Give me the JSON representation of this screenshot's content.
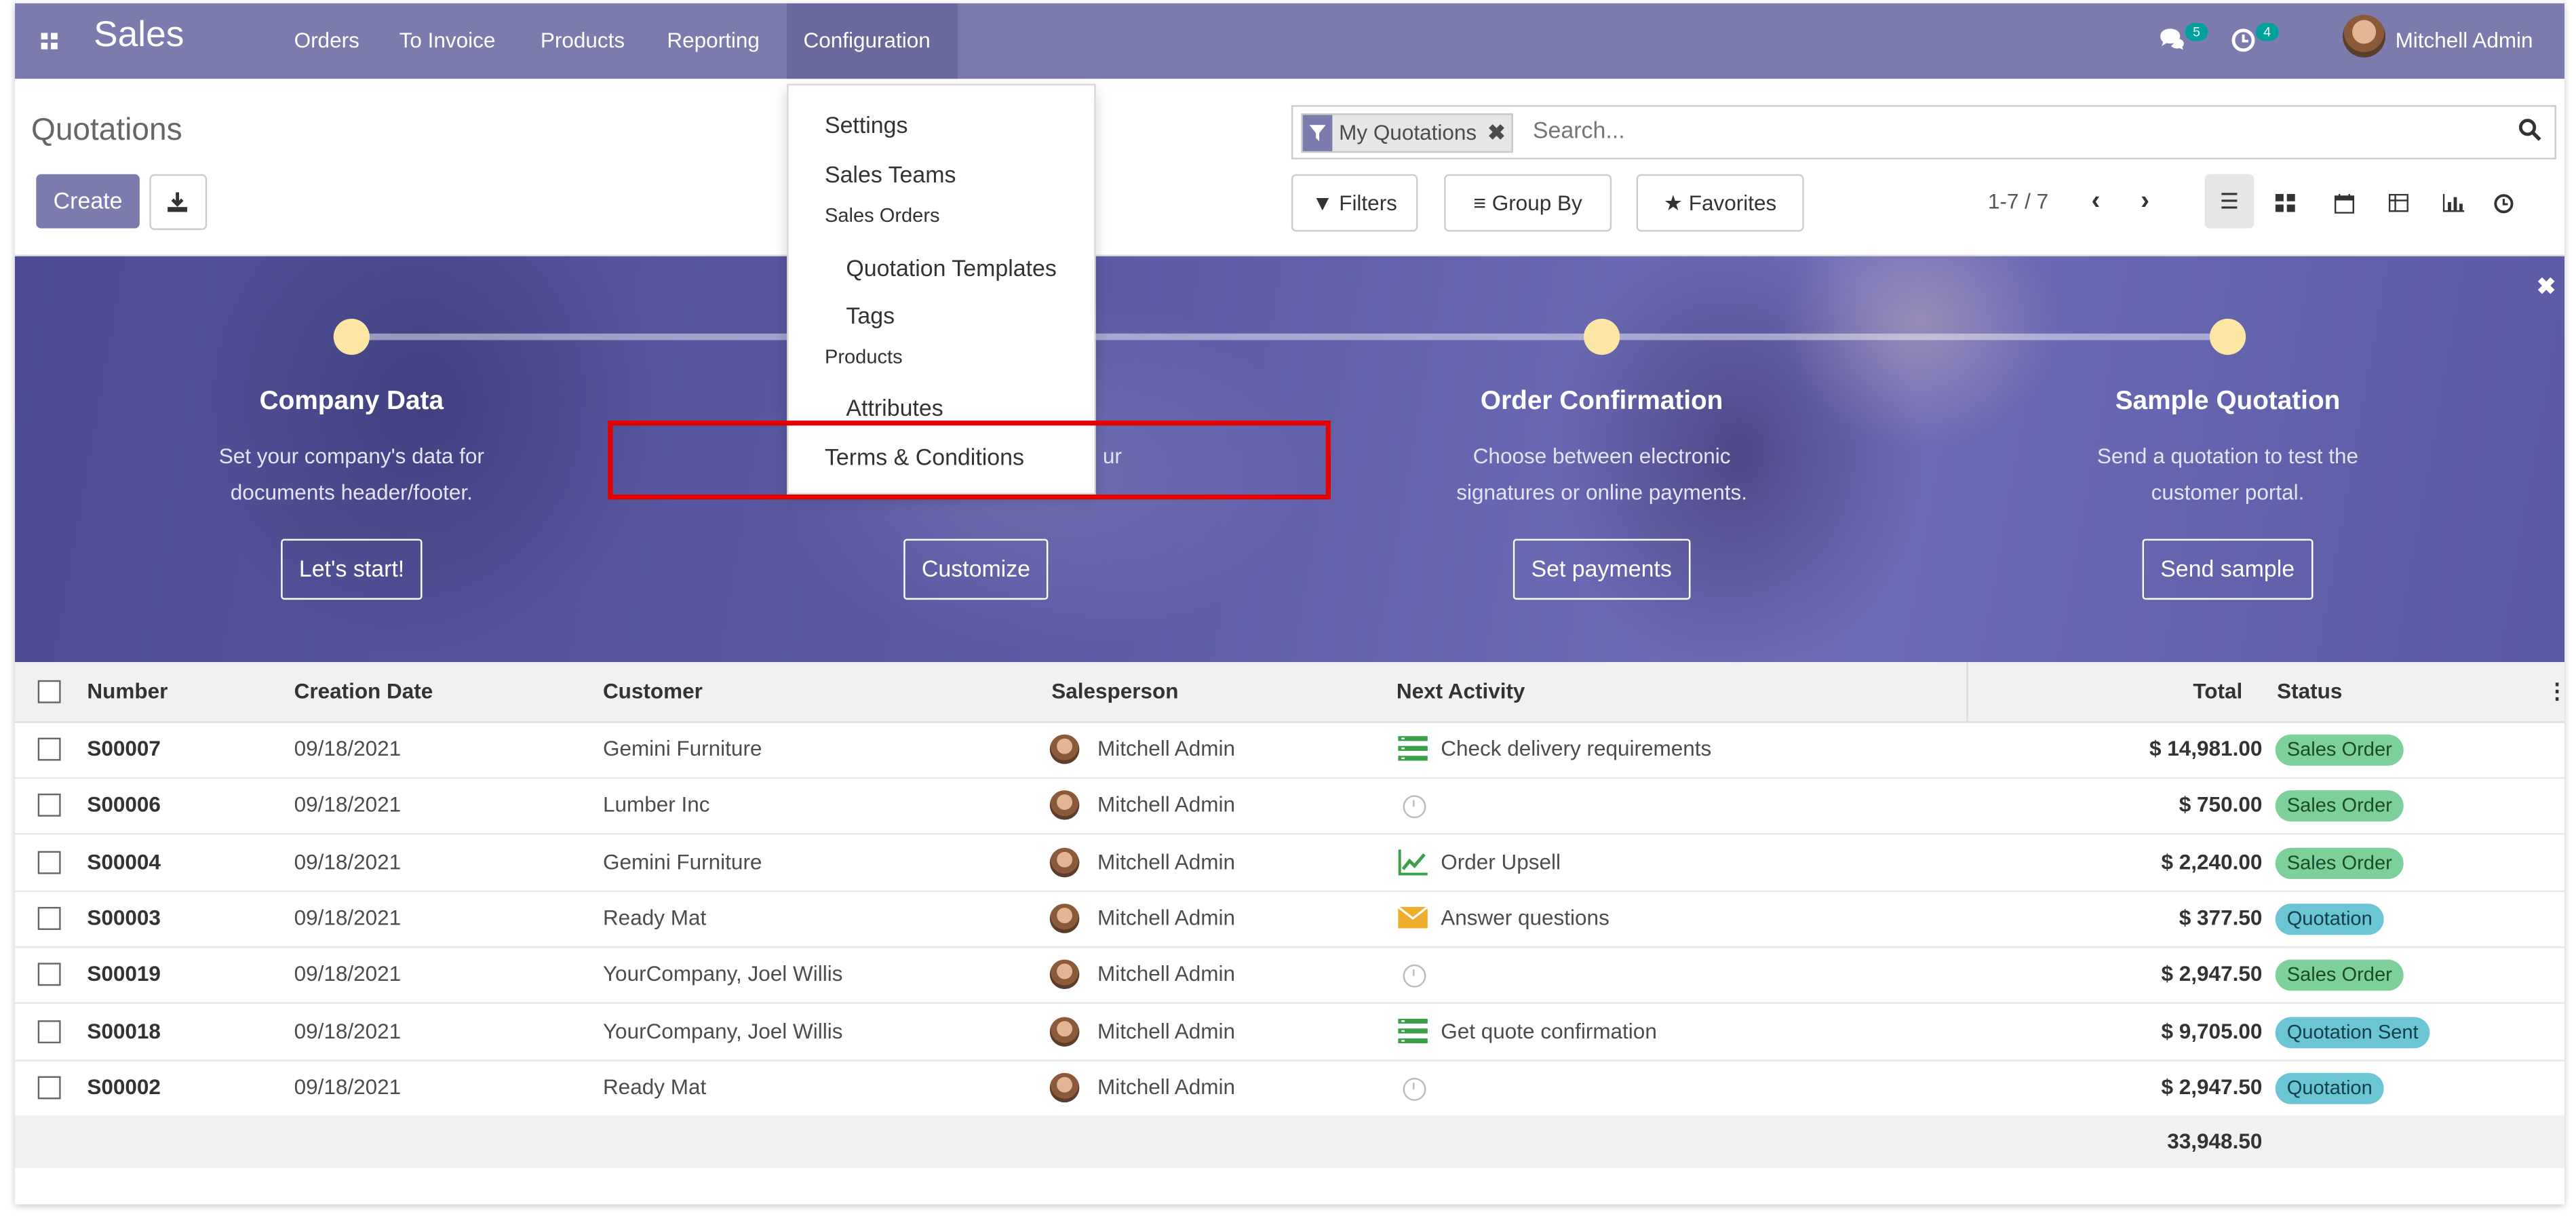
{
  "navbar": {
    "brand": "Sales",
    "menu": [
      "Orders",
      "To Invoice",
      "Products",
      "Reporting",
      "Configuration"
    ],
    "messages_count": "5",
    "activities_count": "4",
    "user": "Mitchell Admin"
  },
  "control_panel": {
    "title": "Quotations",
    "create_label": "Create",
    "facet_label": "My Quotations",
    "search_placeholder": "Search...",
    "filters_label": "Filters",
    "groupby_label": "Group By",
    "favorites_label": "Favorites",
    "pager": "1-7 / 7"
  },
  "dropdown": {
    "items": [
      {
        "label": "Settings",
        "kind": "item"
      },
      {
        "label": "Sales Teams",
        "kind": "item"
      },
      {
        "label": "Sales Orders",
        "kind": "header"
      },
      {
        "label": "Quotation Templates",
        "kind": "sub"
      },
      {
        "label": "Tags",
        "kind": "sub"
      },
      {
        "label": "Products",
        "kind": "header"
      },
      {
        "label": "Attributes",
        "kind": "sub"
      },
      {
        "label": "Terms & Conditions",
        "kind": "item"
      }
    ]
  },
  "banner": {
    "steps": [
      {
        "title": "Company Data",
        "desc1": "Set your company's data for",
        "desc2": "documents header/footer.",
        "button": "Let's start!"
      },
      {
        "title": "",
        "desc1": "ur",
        "desc2": "",
        "button": "Customize"
      },
      {
        "title": "Order Confirmation",
        "desc1": "Choose between electronic",
        "desc2": "signatures or online payments.",
        "button": "Set payments"
      },
      {
        "title": "Sample Quotation",
        "desc1": "Send a quotation to test the",
        "desc2": "customer portal.",
        "button": "Send sample"
      }
    ]
  },
  "table": {
    "headers": [
      "Number",
      "Creation Date",
      "Customer",
      "Salesperson",
      "Next Activity",
      "Total",
      "Status"
    ],
    "rows": [
      {
        "number": "S00007",
        "date": "09/18/2021",
        "customer": "Gemini Furniture",
        "salesperson": "Mitchell Admin",
        "activity": "Check delivery requirements",
        "activity_icon": "list-icon",
        "total": "$ 14,981.00",
        "status": "Sales Order",
        "status_color": "green"
      },
      {
        "number": "S00006",
        "date": "09/18/2021",
        "customer": "Lumber Inc",
        "salesperson": "Mitchell Admin",
        "activity": "",
        "activity_icon": "clock-icon",
        "total": "$ 750.00",
        "status": "Sales Order",
        "status_color": "green"
      },
      {
        "number": "S00004",
        "date": "09/18/2021",
        "customer": "Gemini Furniture",
        "salesperson": "Mitchell Admin",
        "activity": "Order Upsell",
        "activity_icon": "chart-icon",
        "total": "$ 2,240.00",
        "status": "Sales Order",
        "status_color": "green"
      },
      {
        "number": "S00003",
        "date": "09/18/2021",
        "customer": "Ready Mat",
        "salesperson": "Mitchell Admin",
        "activity": "Answer questions",
        "activity_icon": "envelope-icon",
        "total": "$ 377.50",
        "status": "Quotation",
        "status_color": "blue"
      },
      {
        "number": "S00019",
        "date": "09/18/2021",
        "customer": "YourCompany, Joel Willis",
        "salesperson": "Mitchell Admin",
        "activity": "",
        "activity_icon": "clock-icon",
        "total": "$ 2,947.50",
        "status": "Sales Order",
        "status_color": "green"
      },
      {
        "number": "S00018",
        "date": "09/18/2021",
        "customer": "YourCompany, Joel Willis",
        "salesperson": "Mitchell Admin",
        "activity": "Get quote confirmation",
        "activity_icon": "list-icon",
        "total": "$ 9,705.00",
        "status": "Quotation Sent",
        "status_color": "blue"
      },
      {
        "number": "S00002",
        "date": "09/18/2021",
        "customer": "Ready Mat",
        "salesperson": "Mitchell Admin",
        "activity": "",
        "activity_icon": "clock-icon",
        "total": "$ 2,947.50",
        "status": "Quotation",
        "status_color": "blue"
      }
    ],
    "footer_total": "33,948.50"
  },
  "colors": {
    "primary": "#7c7bad",
    "highlight": "#e50000",
    "status_green": "#7ed09a",
    "status_blue": "#6cc5d4"
  }
}
